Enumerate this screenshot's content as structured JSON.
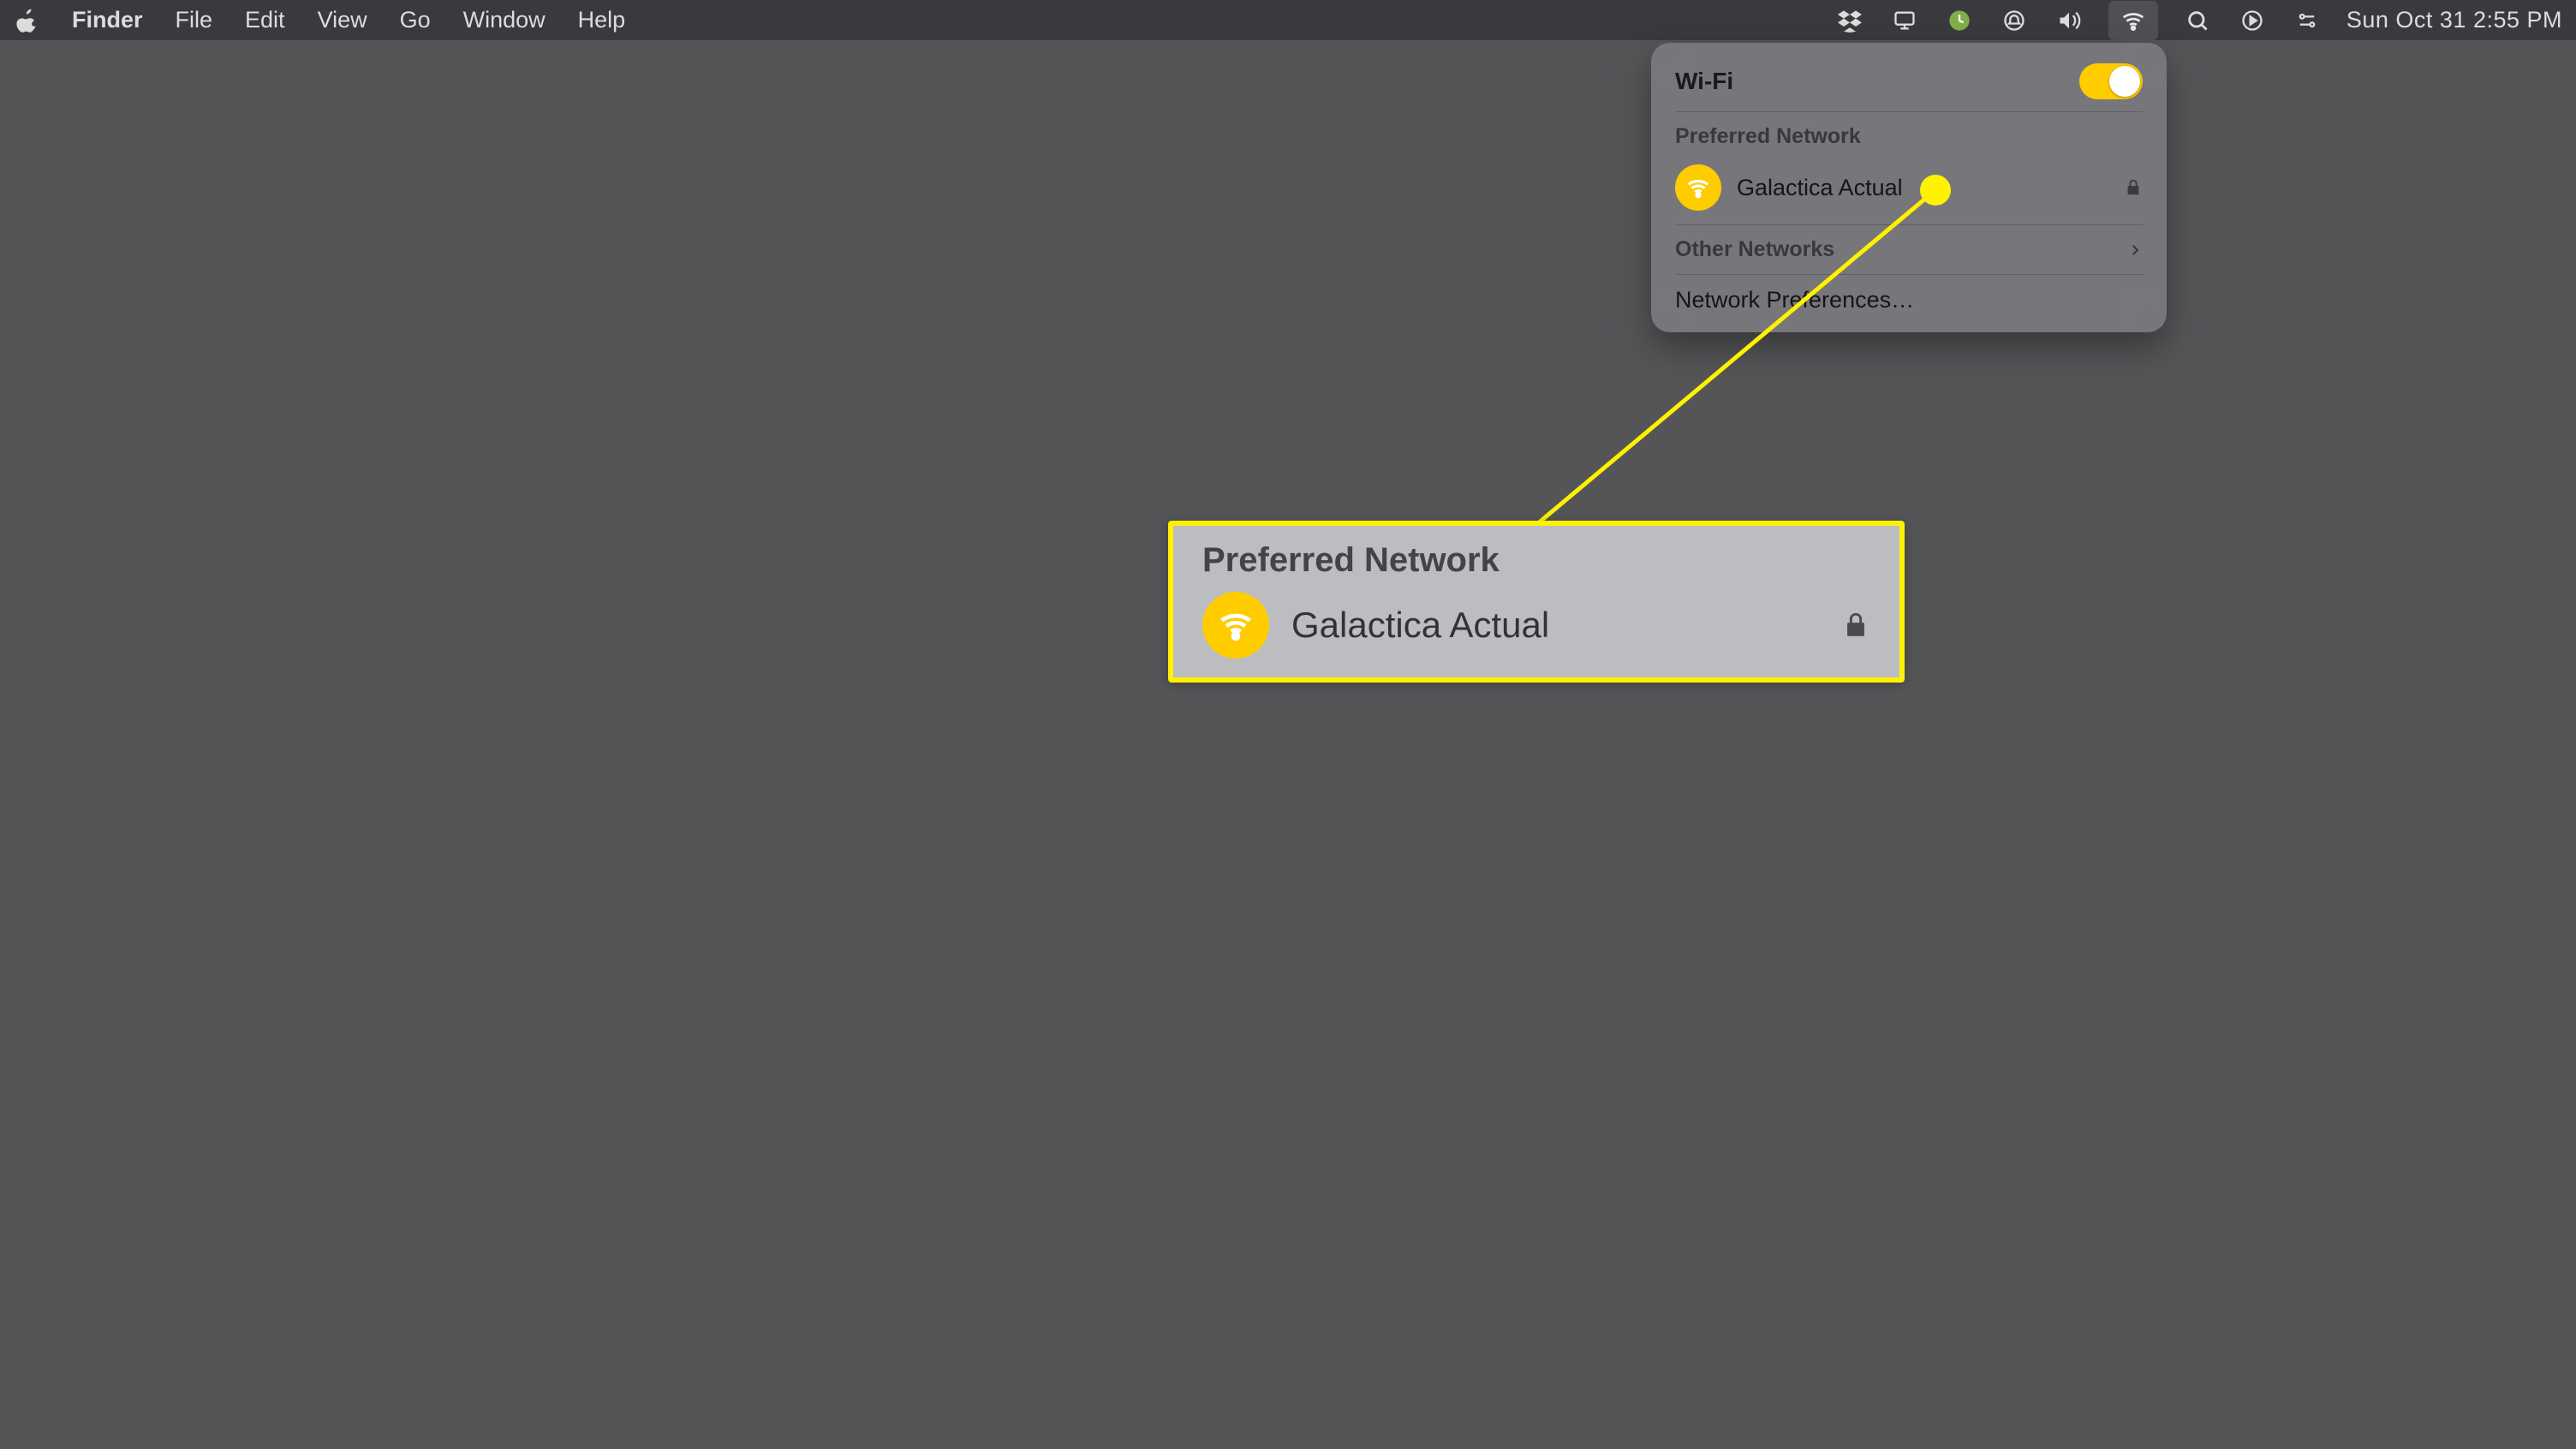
{
  "menubar": {
    "app_name": "Finder",
    "menus": [
      "File",
      "Edit",
      "View",
      "Go",
      "Window",
      "Help"
    ],
    "clock": "Sun Oct 31  2:55 PM"
  },
  "wifi_panel": {
    "title": "Wi-Fi",
    "toggle_on": true,
    "preferred_label": "Preferred Network",
    "preferred_network": {
      "name": "Galactica Actual",
      "secured": true
    },
    "other_label": "Other Networks",
    "prefs_label": "Network Preferences…"
  },
  "callout": {
    "section_label": "Preferred Network",
    "network_name": "Galactica Actual"
  },
  "colors": {
    "accent": "#ffcc00",
    "highlight": "#fff200"
  }
}
